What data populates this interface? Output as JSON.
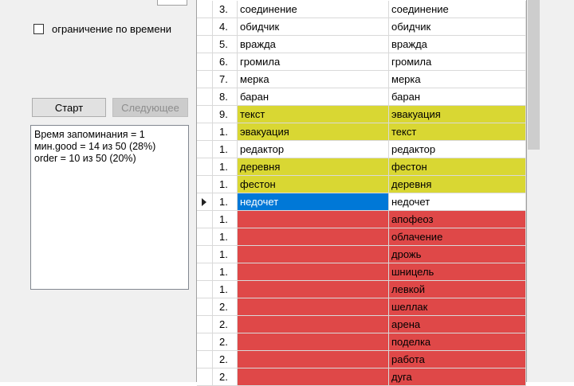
{
  "left": {
    "time_limit_checkbox": {
      "label": "ограничение по времени",
      "checked": false
    },
    "buttons": {
      "start": "Старт",
      "next": "Следующее"
    },
    "result_lines": [
      "Время запоминания = 1",
      "мин.good = 14 из 50 (28%)",
      "order = 10 из 50 (20%)"
    ]
  },
  "colors": {
    "match_yellow": "#d9d733",
    "error_red": "#df4848",
    "selected_blue": "#0078d7"
  },
  "rows": [
    {
      "num": "3.",
      "word": "соединение",
      "answer": "соединение",
      "state": "normal"
    },
    {
      "num": "4.",
      "word": "обидчик",
      "answer": "обидчик",
      "state": "normal"
    },
    {
      "num": "5.",
      "word": "вражда",
      "answer": "вражда",
      "state": "normal"
    },
    {
      "num": "6.",
      "word": "громила",
      "answer": "громила",
      "state": "normal"
    },
    {
      "num": "7.",
      "word": "мерка",
      "answer": "мерка",
      "state": "normal"
    },
    {
      "num": "8.",
      "word": "баран",
      "answer": "баран",
      "state": "normal"
    },
    {
      "num": "9.",
      "word": "текст",
      "answer": "эвакуация",
      "state": "yellow"
    },
    {
      "num": "1.",
      "word": "эвакуация",
      "answer": "текст",
      "state": "yellow"
    },
    {
      "num": "1.",
      "word": "редактор",
      "answer": "редактор",
      "state": "normal"
    },
    {
      "num": "1.",
      "word": "деревня",
      "answer": "фестон",
      "state": "yellow"
    },
    {
      "num": "1.",
      "word": "фестон",
      "answer": "деревня",
      "state": "yellow"
    },
    {
      "num": "1.",
      "word": "недочет",
      "answer": "недочет",
      "state": "current"
    },
    {
      "num": "1.",
      "word": "",
      "answer": "апофеоз",
      "state": "red"
    },
    {
      "num": "1.",
      "word": "",
      "answer": "облачение",
      "state": "red"
    },
    {
      "num": "1.",
      "word": "",
      "answer": "дрожь",
      "state": "red"
    },
    {
      "num": "1.",
      "word": "",
      "answer": "шницель",
      "state": "red"
    },
    {
      "num": "1.",
      "word": "",
      "answer": "левкой",
      "state": "red"
    },
    {
      "num": "2.",
      "word": "",
      "answer": "шеллак",
      "state": "red"
    },
    {
      "num": "2.",
      "word": "",
      "answer": "арена",
      "state": "red"
    },
    {
      "num": "2.",
      "word": "",
      "answer": "поделка",
      "state": "red"
    },
    {
      "num": "2.",
      "word": "",
      "answer": "работа",
      "state": "red"
    },
    {
      "num": "2.",
      "word": "",
      "answer": "дуга",
      "state": "red"
    }
  ]
}
